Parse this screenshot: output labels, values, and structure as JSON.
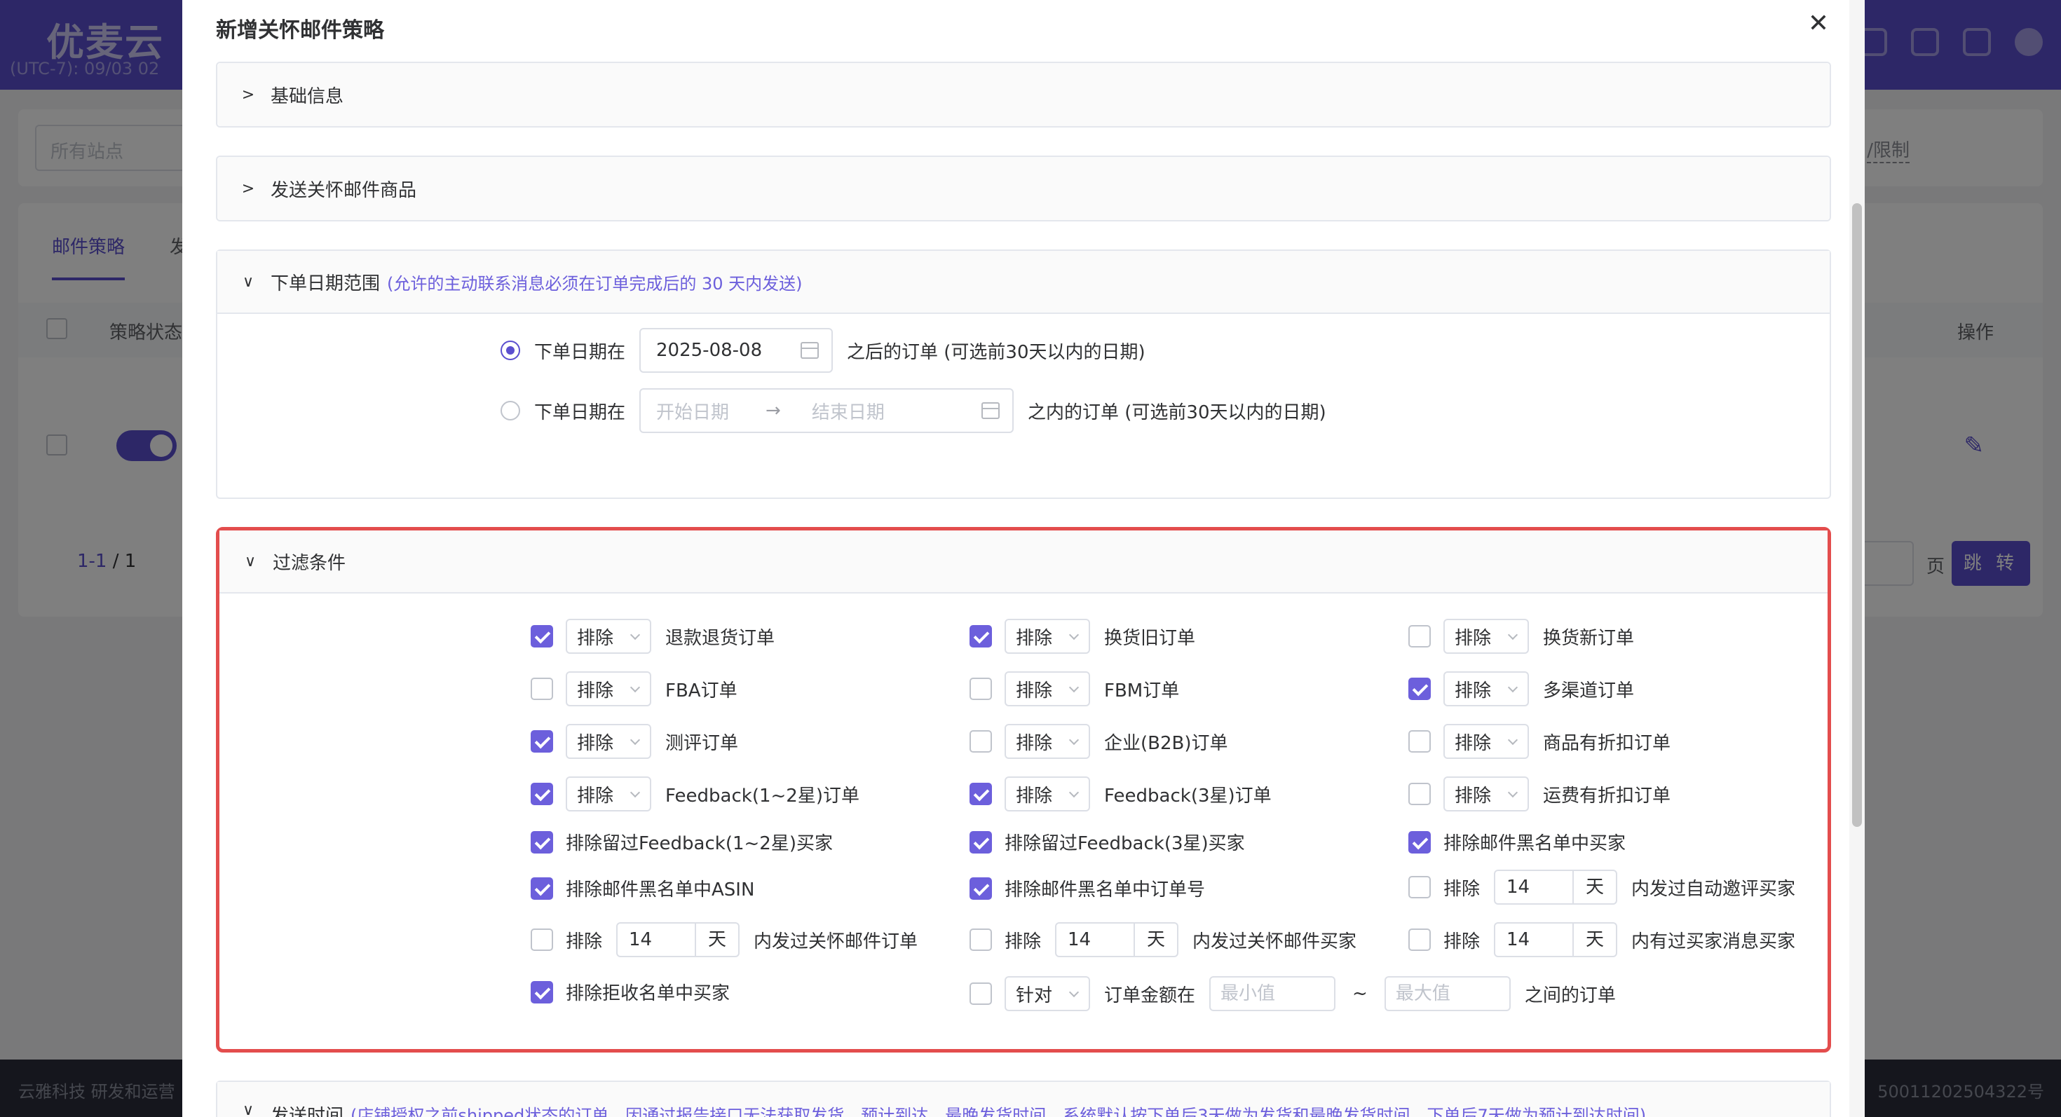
{
  "background": {
    "logo": "优麦云",
    "timezone": "(UTC-7): 09/03 02",
    "site_placeholder": "所有站点",
    "limit_link": "/限制",
    "tabs": [
      "邮件策略",
      "发"
    ],
    "col_status": "策略状态",
    "col_op": "操作",
    "pager_range": "1-1",
    "pager_total": "/ 1",
    "jump_unit": "页",
    "jump_button": "跳 转",
    "footer_left": "云雅科技 研发和运营",
    "footer_right": "50011202504322号"
  },
  "modal": {
    "title": "新增关怀邮件策略",
    "close_icon": "close-icon",
    "sections": {
      "basic": {
        "title": "基础信息"
      },
      "products": {
        "title": "发送关怀邮件商品"
      },
      "order_date": {
        "title": "下单日期范围",
        "hint": "(允许的主动联系消息必须在订单完成后的 30 天内发送)",
        "option1_label": "下单日期在",
        "option1_value": "2025-08-08",
        "option1_suffix": "之后的订单 (可选前30天以内的日期)",
        "option2_label": "下单日期在",
        "option2_start_placeholder": "开始日期",
        "option2_end_placeholder": "结束日期",
        "option2_suffix": "之内的订单 (可选前30天以内的日期)"
      },
      "filters": {
        "title": "过滤条件",
        "exclude": "排除",
        "target": "针对",
        "day_unit": "天",
        "r1c1": "退款退货订单",
        "r1c2": "换货旧订单",
        "r1c3": "换货新订单",
        "r2c1": "FBA订单",
        "r2c2": "FBM订单",
        "r2c3": "多渠道订单",
        "r3c1": "测评订单",
        "r3c2": "企业(B2B)订单",
        "r3c3": "商品有折扣订单",
        "r4c1": "Feedback(1~2星)订单",
        "r4c2": "Feedback(3星)订单",
        "r4c3": "运费有折扣订单",
        "r5c1": "排除留过Feedback(1~2星)买家",
        "r5c2": "排除留过Feedback(3星)买家",
        "r5c3": "排除邮件黑名单中买家",
        "r6c1": "排除邮件黑名单中ASIN",
        "r6c2": "排除邮件黑名单中订单号",
        "r6c3_days": "14",
        "r6c3_suffix": "内发过自动邀评买家",
        "r7c1_days": "14",
        "r7c1_suffix": "内发过关怀邮件订单",
        "r7c2_days": "14",
        "r7c2_suffix": "内发过关怀邮件买家",
        "r7c3_days": "14",
        "r7c3_suffix": "内有过买家消息买家",
        "r8c1": "排除拒收名单中买家",
        "r8c2_label": "订单金额在",
        "r8c2_min_placeholder": "最小值",
        "r8c2_tilde": "~",
        "r8c2_max_placeholder": "最大值",
        "r8c2_suffix": "之间的订单"
      },
      "send_time": {
        "title": "发送时间",
        "hint": "(店铺授权之前shipped状态的订单，因通过报告接口无法获取发货、预计到达、最晚发货时间，系统默认按下单后3天做为发货和最晚发货时间，下单后7天做为预计到达时间)"
      }
    }
  },
  "checkbox_states": {
    "r1c1": true,
    "r1c2": true,
    "r1c3": false,
    "r2c1": false,
    "r2c2": false,
    "r2c3": true,
    "r3c1": true,
    "r3c2": false,
    "r3c3": false,
    "r4c1": true,
    "r4c2": true,
    "r4c3": false,
    "r5c1": true,
    "r5c2": true,
    "r5c3": true,
    "r6c1": true,
    "r6c2": true,
    "r6c3": false,
    "r7c1": false,
    "r7c2": false,
    "r7c3": false,
    "r8c1": true,
    "r8c2": false
  },
  "colors": {
    "accent": "#5b4fcf",
    "checkbox": "#6c5fdc",
    "highlight_border": "#e34d4d"
  }
}
